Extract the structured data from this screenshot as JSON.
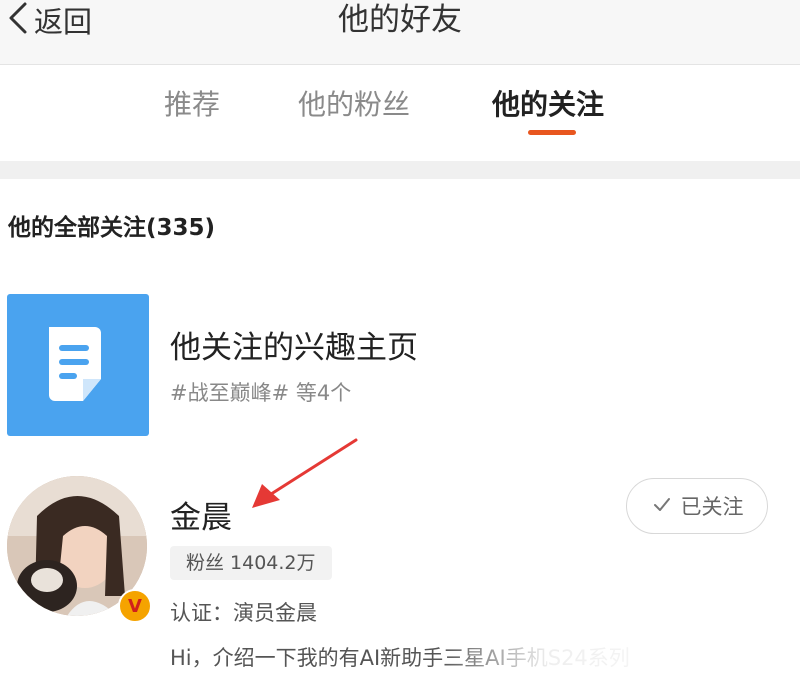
{
  "header": {
    "back_label": "返回",
    "title": "他的好友"
  },
  "tabs": [
    {
      "label": "推荐",
      "active": false
    },
    {
      "label": "他的粉丝",
      "active": false
    },
    {
      "label": "他的关注",
      "active": true
    }
  ],
  "colors": {
    "accent": "#e8561f",
    "interest_icon_bg": "#4aa3ef",
    "annotation_arrow": "#e53935"
  },
  "section": {
    "title": "他的全部关注(335)"
  },
  "interest_page": {
    "icon": "document-icon",
    "title": "他关注的兴趣主页",
    "subtitle": "#战至巅峰# 等4个"
  },
  "user": {
    "name": "金晨",
    "fans": "粉丝 1404.2万",
    "verified": "认证：演员金晨",
    "bio": "Hi，介绍一下我的有AI新助手三星AI手机S24系列",
    "follow_label": "已关注",
    "badge": "V"
  }
}
